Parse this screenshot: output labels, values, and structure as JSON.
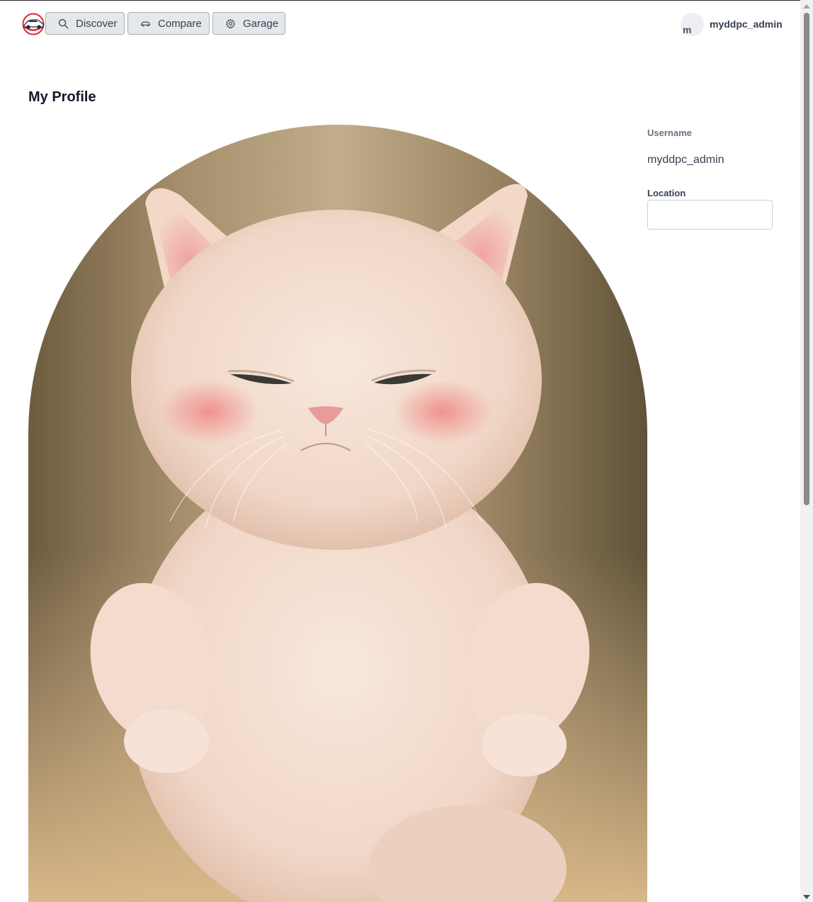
{
  "nav": {
    "items": [
      {
        "label": "Discover",
        "icon": "search-icon"
      },
      {
        "label": "Compare",
        "icon": "car-icon"
      },
      {
        "label": "Garage",
        "icon": "gear-icon"
      }
    ]
  },
  "user": {
    "avatar_initial": "m",
    "name": "myddpc_admin"
  },
  "profile": {
    "title": "My Profile",
    "username_label": "Username",
    "username_value": "myddpc_admin",
    "location_label": "Location",
    "location_value": "",
    "photo_subject": "cat-photo"
  },
  "colors": {
    "button_bg": "#e5e7eb",
    "button_border": "#a8adb5",
    "logo_red": "#d92d3a"
  }
}
